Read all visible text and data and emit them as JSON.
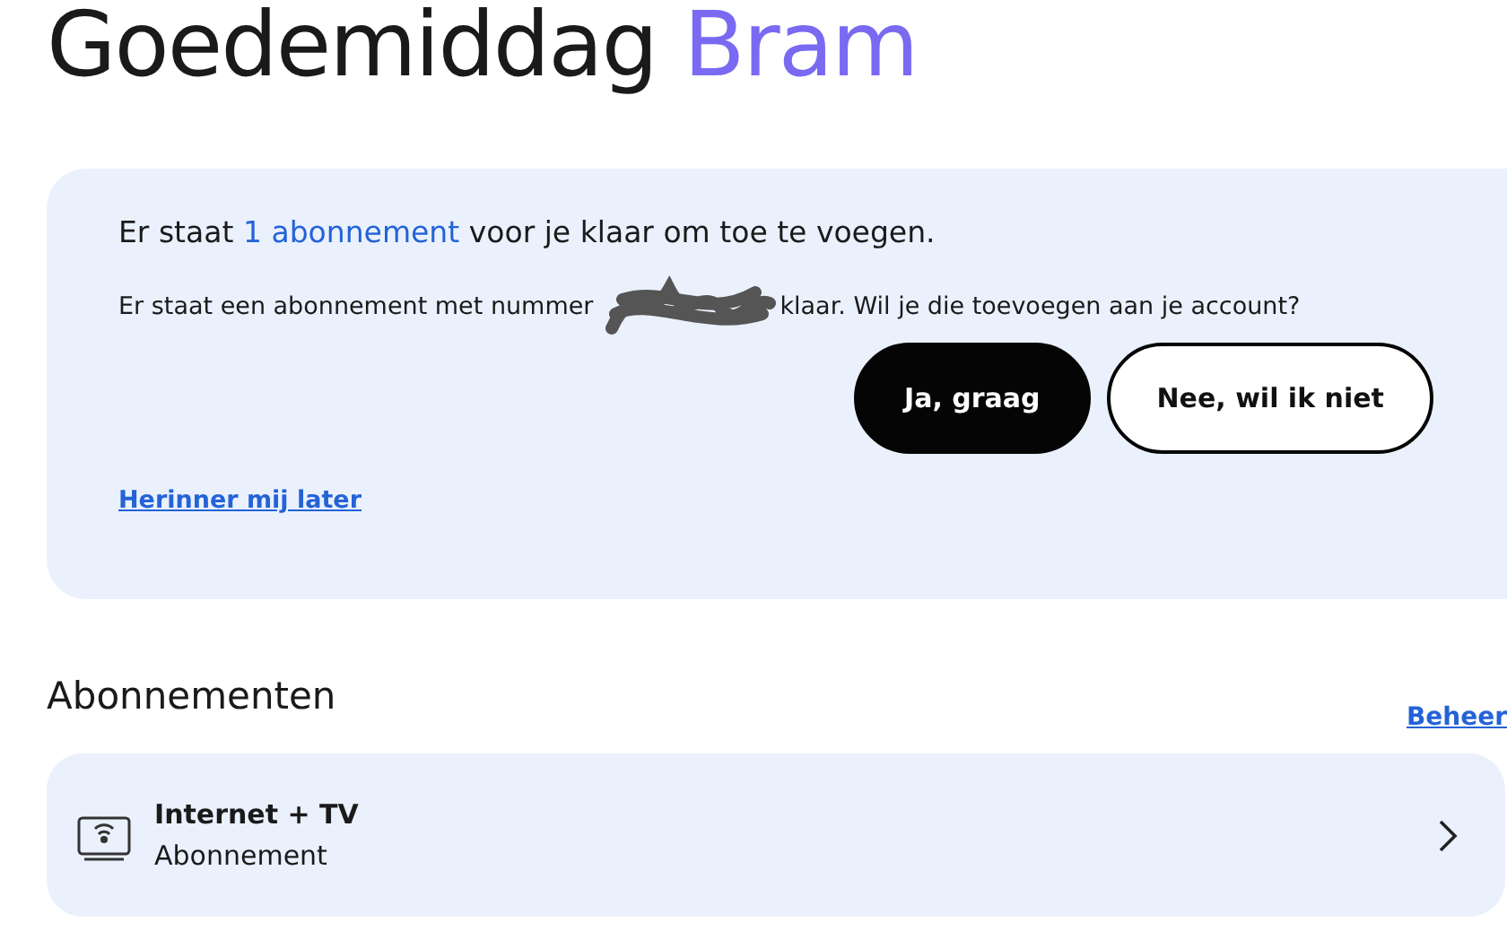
{
  "greeting": {
    "text": "Goedemiddag",
    "name": "Bram"
  },
  "notice": {
    "title_before": "Er staat",
    "title_link": "1 abonnement",
    "title_after": "voor je klaar om toe te voegen.",
    "text_before": "Er staat een abonnement met nummer",
    "text_after": "klaar. Wil je die toevoegen aan je account?",
    "buttons": [
      {
        "label": "Ja, graag",
        "kind": "primary"
      },
      {
        "label": "Nee, wil ik niet",
        "kind": "secondary"
      }
    ],
    "later_link": "Herinner mij later"
  },
  "subscriptions": {
    "title": "Abonnementen",
    "manage_link": "Beheer",
    "items": [
      {
        "name": "Internet + TV",
        "type": "Abonnement"
      }
    ]
  }
}
